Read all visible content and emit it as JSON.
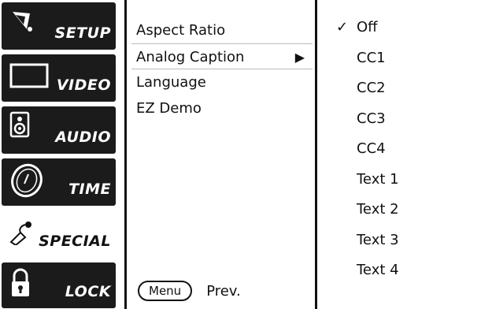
{
  "tabs": [
    {
      "label": "SETUP",
      "icon": "satellite-dish-icon",
      "active": false
    },
    {
      "label": "VIDEO",
      "icon": "screen-icon",
      "active": false
    },
    {
      "label": "AUDIO",
      "icon": "speaker-icon",
      "active": false
    },
    {
      "label": "TIME",
      "icon": "clock-icon",
      "active": false
    },
    {
      "label": "SPECIAL",
      "icon": "magic-wand-icon",
      "active": true
    },
    {
      "label": "LOCK",
      "icon": "padlock-icon",
      "active": false
    }
  ],
  "menu": {
    "items": [
      {
        "label": "Aspect Ratio"
      },
      {
        "label": "Analog Caption",
        "selected": true
      },
      {
        "label": "Language"
      },
      {
        "label": "EZ Demo"
      }
    ]
  },
  "options": {
    "checked_index": 0,
    "items": [
      "Off",
      "CC1",
      "CC2",
      "CC3",
      "CC4",
      "Text 1",
      "Text 2",
      "Text 3",
      "Text 4"
    ]
  },
  "footer": {
    "menu_button": "Menu",
    "prev_label": "Prev."
  },
  "colors": {
    "tab_bg": "#1b1b1b",
    "active_tab_bg": "#ffffff",
    "text": "#111111"
  }
}
